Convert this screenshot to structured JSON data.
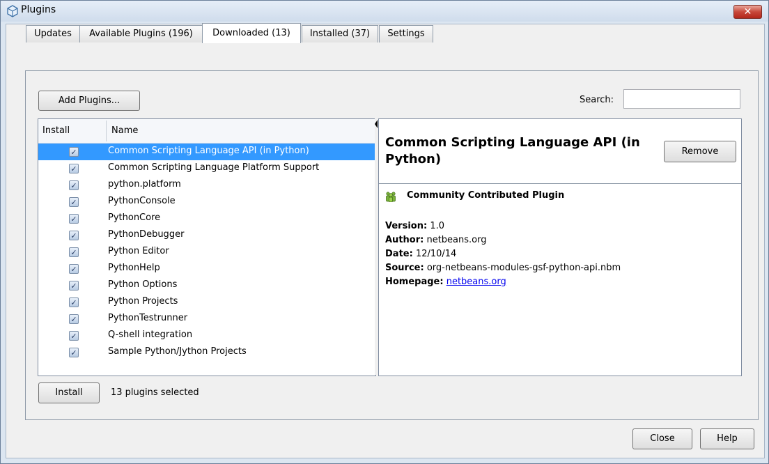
{
  "window": {
    "title": "Plugins",
    "close_glyph": "✕"
  },
  "tabs": [
    {
      "label": "Updates"
    },
    {
      "label": "Available Plugins (196)"
    },
    {
      "label": "Downloaded (13)",
      "active": true
    },
    {
      "label": "Installed (37)"
    },
    {
      "label": "Settings"
    }
  ],
  "toolbar": {
    "add_plugins_label": "Add Plugins...",
    "search_label": "Search:",
    "search_value": ""
  },
  "list": {
    "columns": {
      "install": "Install",
      "name": "Name"
    },
    "rows": [
      {
        "name": "Common Scripting Language API (in Python)",
        "checked": true,
        "selected": true
      },
      {
        "name": "Common Scripting Language Platform Support",
        "checked": true
      },
      {
        "name": "python.platform",
        "checked": true
      },
      {
        "name": "PythonConsole",
        "checked": true
      },
      {
        "name": "PythonCore",
        "checked": true
      },
      {
        "name": "PythonDebugger",
        "checked": true
      },
      {
        "name": "Python Editor",
        "checked": true
      },
      {
        "name": "PythonHelp",
        "checked": true
      },
      {
        "name": "Python Options",
        "checked": true
      },
      {
        "name": "Python Projects",
        "checked": true
      },
      {
        "name": "PythonTestrunner",
        "checked": true
      },
      {
        "name": "Q-shell integration",
        "checked": true
      },
      {
        "name": "Sample Python/Jython Projects",
        "checked": true
      }
    ]
  },
  "detail": {
    "title": "Common Scripting Language API (in Python)",
    "remove_label": "Remove",
    "community": "Community Contributed Plugin",
    "version_label": "Version:",
    "version": "1.0",
    "author_label": "Author:",
    "author": "netbeans.org",
    "date_label": "Date:",
    "date": "12/10/14",
    "source_label": "Source:",
    "source": "org-netbeans-modules-gsf-python-api.nbm",
    "homepage_label": "Homepage:",
    "homepage": "netbeans.org"
  },
  "footer": {
    "install_label": "Install",
    "status": "13 plugins selected",
    "close_label": "Close",
    "help_label": "Help"
  }
}
